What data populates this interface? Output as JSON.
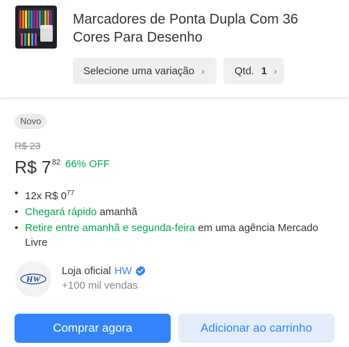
{
  "header": {
    "product_title": "Marcadores de Ponta Dupla Com 36 Cores Para Desenho",
    "variation_label": "Selecione uma variação",
    "quantity_label": "Qtd.",
    "quantity_value": "1"
  },
  "offer": {
    "condition_badge": "Novo",
    "old_price": "R$ 23",
    "price_main": "R$ 7",
    "price_cents": "82",
    "discount": "66% OFF"
  },
  "details": {
    "installments_prefix": "12x R$ 0",
    "installments_cents": "77",
    "shipping_highlight": "Chegará rápido",
    "shipping_rest": " amanhã",
    "pickup_highlight": "Retire entre amanhã e segunda-feira",
    "pickup_rest": " em uma agência Mercado Livre"
  },
  "seller": {
    "label": "Loja oficial",
    "name": "HW",
    "sales": "+100 mil vendas",
    "logo_text": "HW"
  },
  "actions": {
    "buy_now": "Comprar agora",
    "add_to_cart": "Adicionar ao carrinho"
  },
  "colors": {
    "accent": "#3483fa",
    "green": "#00a650",
    "accent_light": "#e3edfb"
  },
  "icons": {
    "chevron": "chevron-right-icon",
    "verified": "verified-badge-icon"
  }
}
